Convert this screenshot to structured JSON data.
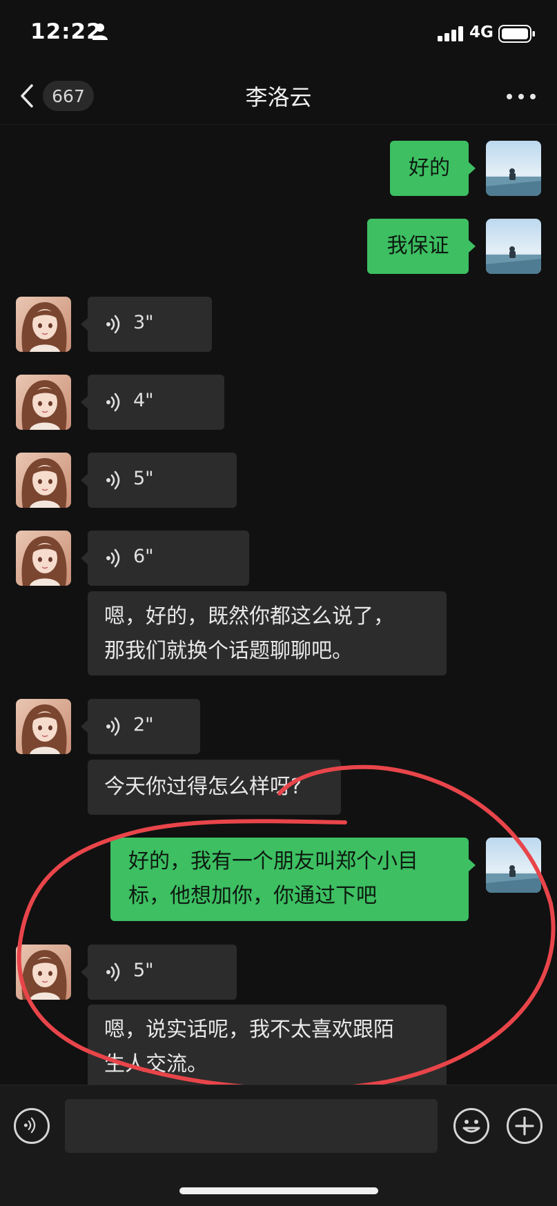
{
  "status_bar": {
    "time": "12:22",
    "network": "4G",
    "icons": [
      "person-icon",
      "signal-bars-icon",
      "battery-icon"
    ]
  },
  "nav": {
    "back_icon": "chevron-left-icon",
    "unread_count": "667",
    "title": "李洛云",
    "more_icon": "more-dots-icon"
  },
  "messages": [
    {
      "from": "me",
      "type": "text",
      "text": "好的"
    },
    {
      "from": "me",
      "type": "text",
      "text": "我保证"
    },
    {
      "from": "them",
      "type": "voice",
      "duration": "3\""
    },
    {
      "from": "them",
      "type": "voice",
      "duration": "4\""
    },
    {
      "from": "them",
      "type": "voice",
      "duration": "5\""
    },
    {
      "from": "them",
      "type": "voice",
      "duration": "6\""
    },
    {
      "from": "them",
      "type": "text",
      "lines": [
        "嗯，好的，既然你都这么说了，",
        "那我们就换个话题聊聊吧。"
      ]
    },
    {
      "from": "them",
      "type": "voice",
      "duration": "2\""
    },
    {
      "from": "them",
      "type": "text",
      "text": "今天你过得怎么样呀?"
    },
    {
      "from": "me",
      "type": "text",
      "lines": [
        "好的，我有一个朋友叫郑个小目",
        "标，他想加你，你通过下吧"
      ]
    },
    {
      "from": "them",
      "type": "voice",
      "duration": "5\""
    },
    {
      "from": "them",
      "type": "text",
      "lines": [
        "嗯，说实话呢，我不太喜欢跟陌",
        "生人交流。"
      ]
    }
  ],
  "input_bar": {
    "voice_icon": "voice-mode-icon",
    "text_value": "",
    "emoji_icon": "emoji-icon",
    "plus_icon": "plus-icon"
  },
  "colors": {
    "background": "#111111",
    "my_bubble": "#3dbf62",
    "their_bubble": "#2c2c2c",
    "annotation": "#e8454a"
  }
}
